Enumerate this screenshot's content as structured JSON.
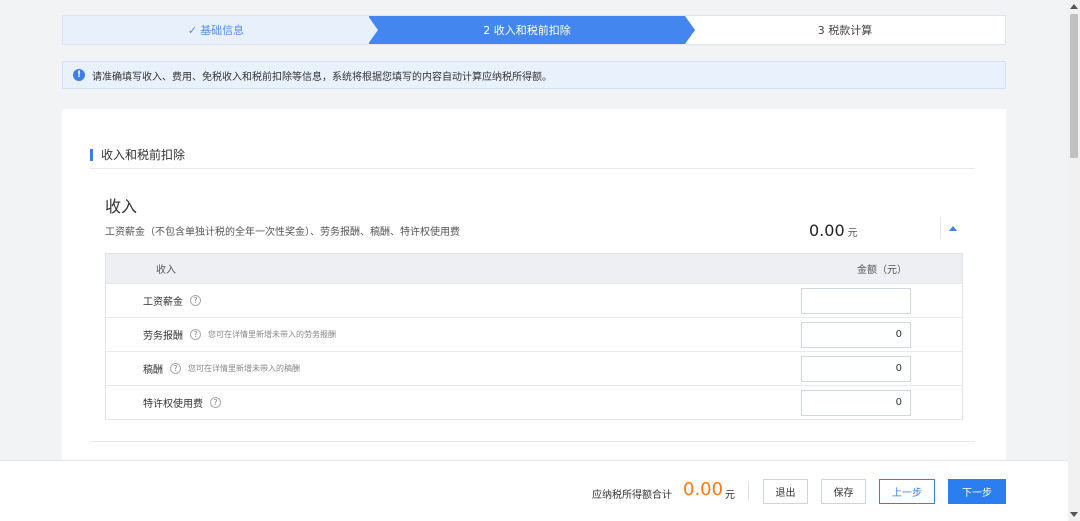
{
  "steps": [
    {
      "check": "✓",
      "label": "基础信息"
    },
    {
      "label": "2 收入和税前扣除"
    },
    {
      "label": "3 税款计算"
    }
  ],
  "notice": {
    "icon": "info-icon",
    "text": "请准确填写收入、费用、免税收入和税前扣除等信息，系统将根据您填写的内容自动计算应纳税所得额。"
  },
  "section": {
    "title": "收入和税前扣除"
  },
  "income": {
    "heading": "收入",
    "subline": "工资薪金（不包含单独计税的全年一次性奖金）、劳务报酬、稿酬、特许权使用费",
    "total": "0.00",
    "unit": "元",
    "table": {
      "headers": [
        "收入",
        "金额（元）"
      ],
      "rows": [
        {
          "label": "工资薪金",
          "hint": "",
          "value": ""
        },
        {
          "label": "劳务报酬",
          "hint": "您可在详情里新增未带入的劳务报酬",
          "value": "0"
        },
        {
          "label": "稿酬",
          "hint": "您可在详情里新增未带入的稿酬",
          "value": "0"
        },
        {
          "label": "特许权使用费",
          "hint": "",
          "value": "0"
        }
      ]
    }
  },
  "footer": {
    "sum_label": "应纳税所得额合计",
    "sum_value": "0.00",
    "sum_unit": "元",
    "buttons": {
      "exit": "退出",
      "save": "保存",
      "prev": "上一步",
      "next": "下一步"
    }
  },
  "colors": {
    "primary": "#2a7ef0",
    "accent": "#f57a1e",
    "step_active": "#4386f0"
  }
}
